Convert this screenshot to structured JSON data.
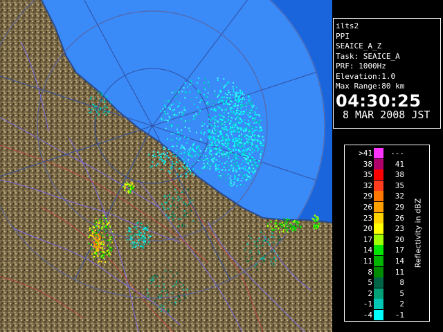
{
  "info": {
    "station": "ilts2",
    "mode": "PPI",
    "product": "SEAICE_A_Z",
    "task": "Task: SEAICE_A",
    "prf": "PRF: 1000Hz",
    "elevation": "Elevation:1.0",
    "max_range": "Max Range:80 km",
    "time": "04:30:25",
    "date": "8 MAR 2008 JST"
  },
  "legend": {
    "title": "Reflectivity in dBZ",
    "rows": [
      {
        "lo": ">41",
        "hi": "---",
        "color": "#ff33ff"
      },
      {
        "lo": "38",
        "hi": "41",
        "color": "#b0006a"
      },
      {
        "lo": "35",
        "hi": "38",
        "color": "#ff0000"
      },
      {
        "lo": "32",
        "hi": "35",
        "color": "#ff3c1e"
      },
      {
        "lo": "29",
        "hi": "32",
        "color": "#ff7800"
      },
      {
        "lo": "26",
        "hi": "29",
        "color": "#ffa000"
      },
      {
        "lo": "23",
        "hi": "26",
        "color": "#ffd200"
      },
      {
        "lo": "20",
        "hi": "23",
        "color": "#ffff00"
      },
      {
        "lo": "17",
        "hi": "20",
        "color": "#a0ff00"
      },
      {
        "lo": "14",
        "hi": "17",
        "color": "#00e600"
      },
      {
        "lo": "11",
        "hi": "14",
        "color": "#00b400"
      },
      {
        "lo": "8",
        "hi": "11",
        "color": "#008c00"
      },
      {
        "lo": "5",
        "hi": "8",
        "color": "#006446"
      },
      {
        "lo": "2",
        "hi": "5",
        "color": "#00a078"
      },
      {
        "lo": "-1",
        "hi": "2",
        "color": "#00c8b4"
      },
      {
        "lo": "-4",
        "hi": "-1",
        "color": "#00ffff"
      }
    ]
  },
  "colors": {
    "sea": "#1e6ee6",
    "radar_range": "#3c8cff",
    "land": "#7a6a48",
    "border": "#ffffff"
  }
}
